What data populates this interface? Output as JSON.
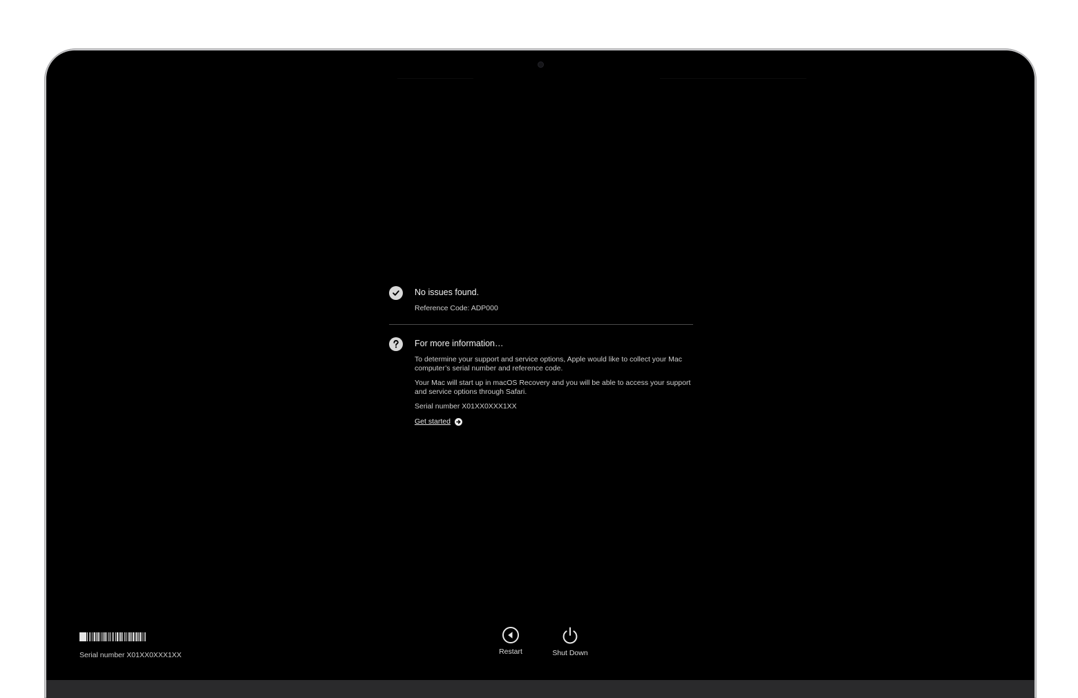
{
  "result": {
    "title": "No issues found.",
    "reference": "Reference Code: ADP000",
    "icon": "checkmark-circle-icon"
  },
  "info": {
    "title": "For more information…",
    "paragraph1": "To determine your support and service options, Apple would like to collect your Mac computer’s serial number and reference code.",
    "paragraph2": "Your Mac will start up in macOS Recovery and you will be able to access your support and service options through Safari.",
    "serial": "Serial number X01XX0XXX1XX",
    "link_label": "Get started",
    "icon": "question-circle-icon"
  },
  "footer": {
    "serial": "Serial number X01XX0XXX1XX",
    "restart_label": "Restart",
    "shutdown_label": "Shut Down"
  },
  "colors": {
    "screen_bg": "#000000",
    "text_primary": "#f2f2f2",
    "text_secondary": "#cfcfcf",
    "divider": "#4a4a4a",
    "bezel": "#c9c9cb"
  }
}
